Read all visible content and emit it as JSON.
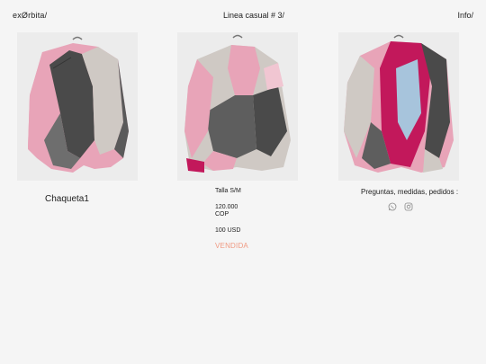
{
  "header": {
    "brand": "exØrbita/",
    "collection": "Linea casual # 3/",
    "info": "Info/"
  },
  "photos": [
    {
      "alt": "Chaqueta1 front view"
    },
    {
      "alt": "Chaqueta1 back view"
    },
    {
      "alt": "Chaqueta1 open view"
    }
  ],
  "product": {
    "name": "Chaqueta1",
    "size": "Talla S/M",
    "price_cop_amount": "120.000",
    "price_cop_currency": "COP",
    "price_usd": "100 USD",
    "status": "VENDIDA"
  },
  "contact": {
    "text": "Preguntas, medidas, pedidos :",
    "icons": [
      "whatsapp-icon",
      "instagram-icon"
    ]
  },
  "colors": {
    "background": "#f5f5f5",
    "sold": "#f09a82",
    "pink": "#e8a4b8",
    "grey": "#cfc9c4",
    "charcoal": "#4a4a4a",
    "magenta": "#c2185b"
  }
}
